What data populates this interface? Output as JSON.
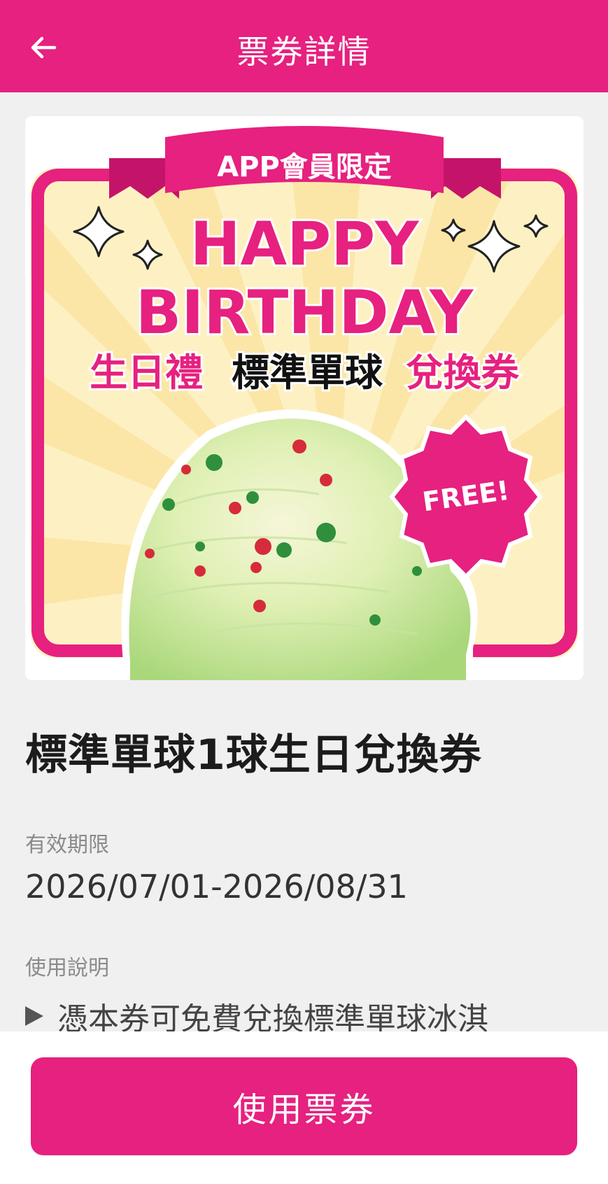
{
  "header": {
    "title": "票券詳情",
    "back_icon": "arrow-left-icon"
  },
  "banner": {
    "badge_text": "APP會員限定",
    "headline_line1": "HAPPY",
    "headline_line2": "BIRTHDAY",
    "subtitle_part1": "生日禮",
    "subtitle_part2": "標準單球",
    "subtitle_part3": "兌換券",
    "free_badge": "FREE!",
    "colors": {
      "brand_pink": "#e6217f",
      "cream": "#fdf1c4",
      "ice_cream_green": "#b8e08a"
    }
  },
  "coupon": {
    "title": "標準單球1球生日兌換券"
  },
  "validity": {
    "label": "有效期限",
    "value": "2026/07/01-2026/08/31"
  },
  "instructions": {
    "label": "使用說明",
    "first_line": "憑本券可免費兌換標準單球冰淇"
  },
  "footer": {
    "use_button_label": "使用票券"
  }
}
